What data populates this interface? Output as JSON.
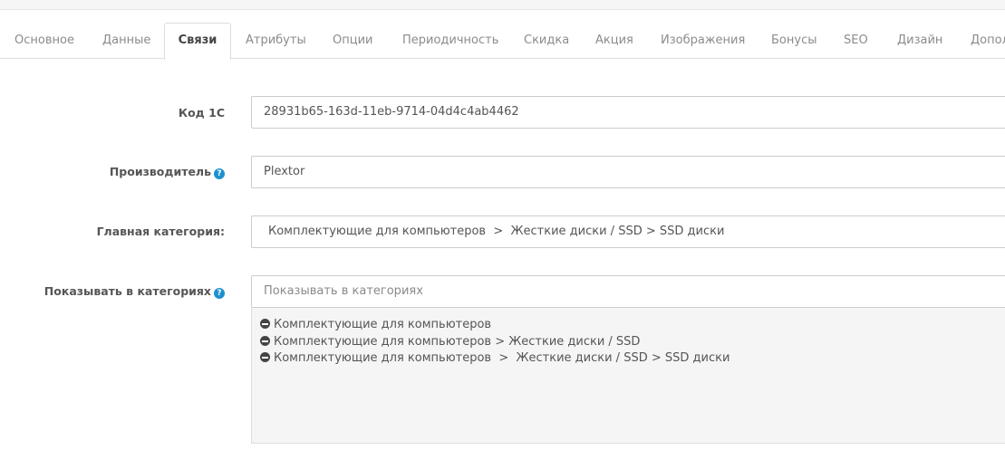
{
  "tabs": [
    {
      "label": "Основное"
    },
    {
      "label": "Данные"
    },
    {
      "label": "Связи"
    },
    {
      "label": "Атрибуты"
    },
    {
      "label": "Опции"
    },
    {
      "label": "Периодичность"
    },
    {
      "label": "Скидка"
    },
    {
      "label": "Акция"
    },
    {
      "label": "Изображения"
    },
    {
      "label": "Бонусы"
    },
    {
      "label": "SEO"
    },
    {
      "label": "Дизайн"
    },
    {
      "label": "Допол"
    }
  ],
  "active_tab": "Связи",
  "form": {
    "code_1c": {
      "label": "Код 1С",
      "value": "28931b65-163d-11eb-9714-04d4c4ab4462"
    },
    "manufacturer": {
      "label": "Производитель",
      "help": "?",
      "value": "Plextor"
    },
    "main_category": {
      "label": "Главная категория:",
      "value": "Комплектующие для компьютеров  >  Жесткие диски / SSD > SSD диски"
    },
    "show_in_categories": {
      "label": "Показывать в категориях",
      "help": "?",
      "placeholder": "Показывать в категориях",
      "items": [
        "Комплектующие для компьютеров",
        "Комплектующие для компьютеров > Жесткие диски / SSD",
        "Комплектующие для компьютеров  >  Жесткие диски / SSD > SSD диски"
      ]
    }
  },
  "colors": {
    "accent": "#1e91cf",
    "remove_icon": "#444444",
    "well_bg": "#f5f5f5"
  }
}
